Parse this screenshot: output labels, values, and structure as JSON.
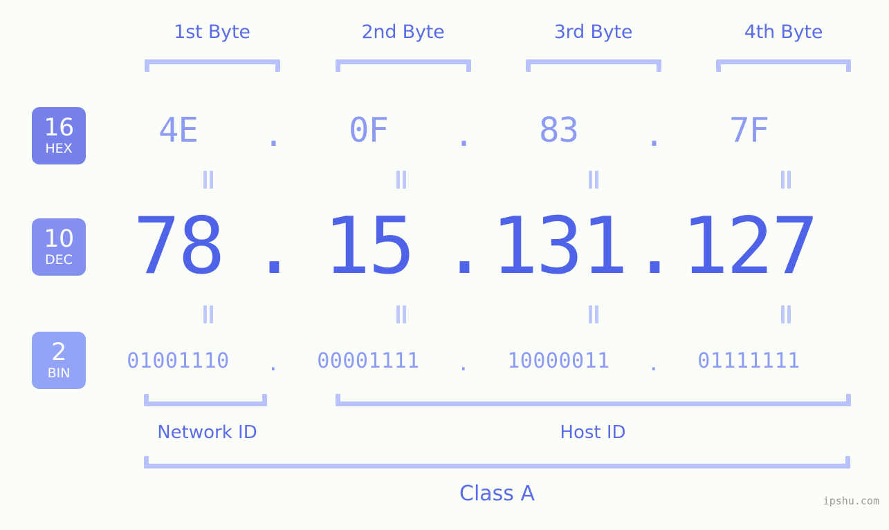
{
  "watermark": "ipshu.com",
  "background_color": "#fbfdf8",
  "accent_colors": {
    "dec_text": "#4f63e8",
    "light_text": "#8d9bf2",
    "label_text": "#5b6ce8",
    "bracket": "#b9c1fb",
    "badge_hex": "#7581e8",
    "badge_dec": "#8390f0",
    "badge_bin": "#93a4f7"
  },
  "byte_headers": [
    {
      "label": "1st Byte"
    },
    {
      "label": "2nd Byte"
    },
    {
      "label": "3rd Byte"
    },
    {
      "label": "4th Byte"
    }
  ],
  "bases": [
    {
      "number": "16",
      "abbr": "HEX"
    },
    {
      "number": "10",
      "abbr": "DEC"
    },
    {
      "number": "2",
      "abbr": "BIN"
    }
  ],
  "separator": ".",
  "rows": {
    "hex": {
      "base": "16",
      "abbr": "HEX",
      "values": [
        "4E",
        "0F",
        "83",
        "7F"
      ]
    },
    "dec": {
      "base": "10",
      "abbr": "DEC",
      "values": [
        "78",
        "15",
        "131",
        "127"
      ]
    },
    "bin": {
      "base": "2",
      "abbr": "BIN",
      "values": [
        "01001110",
        "00001111",
        "10000011",
        "01111111"
      ]
    }
  },
  "partitions": [
    {
      "label": "Network ID"
    },
    {
      "label": "Host ID"
    }
  ],
  "class": {
    "label": "Class A"
  }
}
